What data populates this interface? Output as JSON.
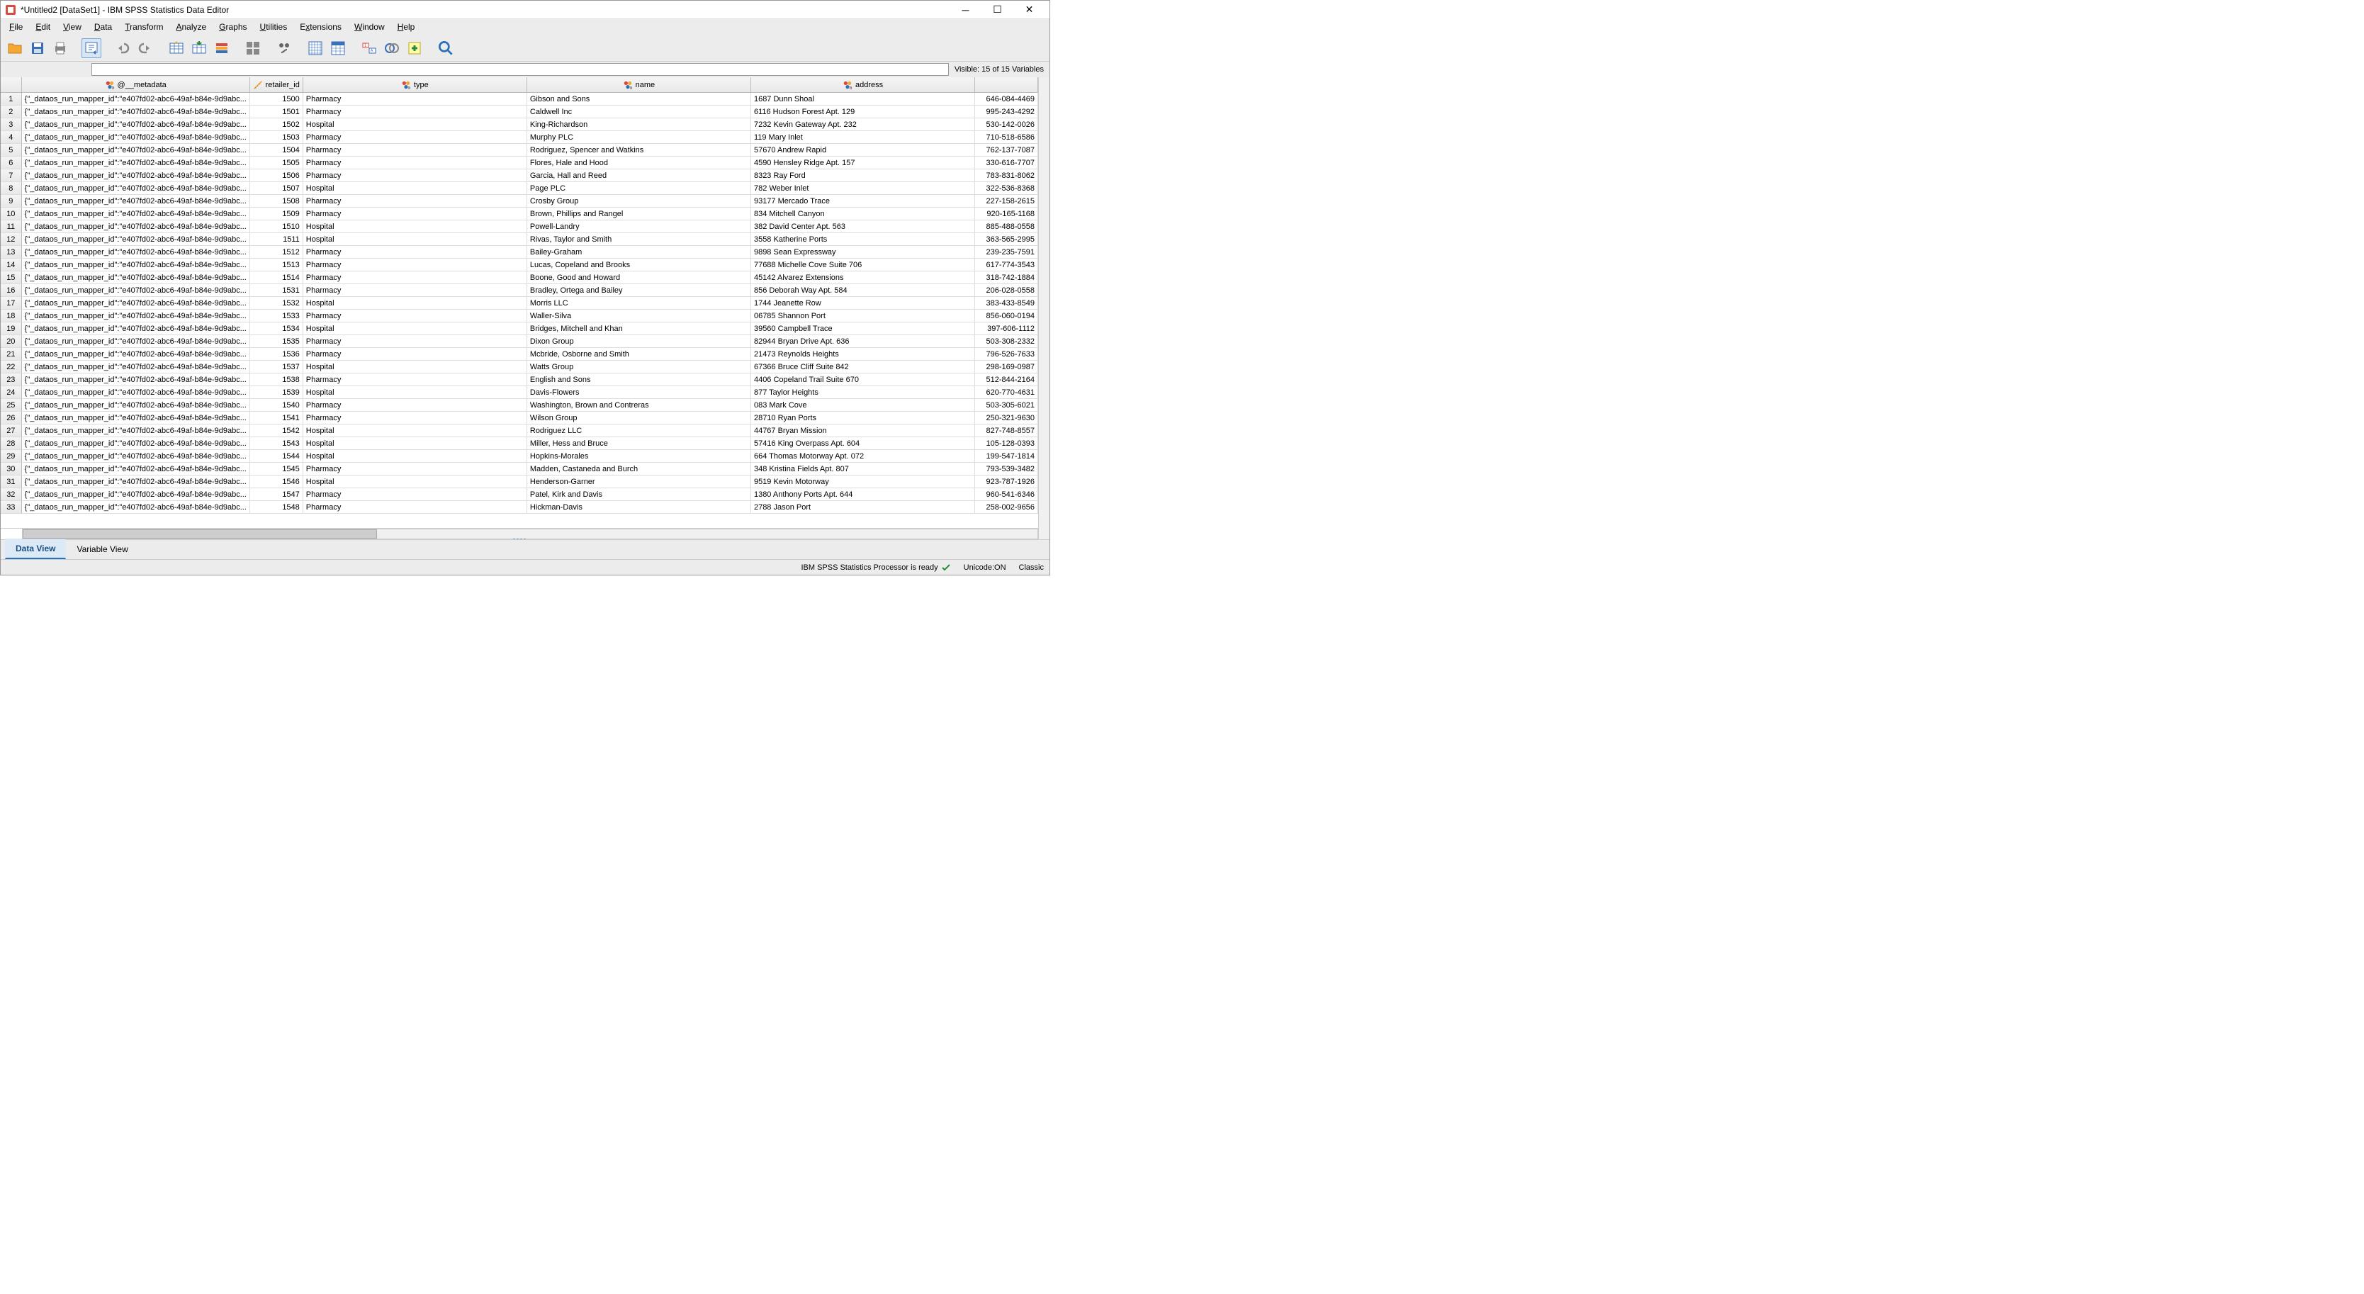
{
  "window": {
    "title": "*Untitled2 [DataSet1] - IBM SPSS Statistics Data Editor"
  },
  "menus": {
    "file": "File",
    "edit": "Edit",
    "view": "View",
    "data": "Data",
    "transform": "Transform",
    "analyze": "Analyze",
    "graphs": "Graphs",
    "utilities": "Utilities",
    "extensions": "Extensions",
    "window": "Window",
    "help": "Help"
  },
  "info": {
    "visible": "Visible: 15 of 15 Variables"
  },
  "columns": {
    "metadata": "@__metadata",
    "retailer_id": "retailer_id",
    "type": "type",
    "name": "name",
    "address": "address"
  },
  "metadata_text": "{\"_dataos_run_mapper_id\":\"e407fd02-abc6-49af-b84e-9d9abc...",
  "rows": [
    {
      "n": 1,
      "id": "1500",
      "type": "Pharmacy",
      "name": "Gibson and Sons",
      "addr": "1687 Dunn Shoal",
      "ph": "646-084-4469"
    },
    {
      "n": 2,
      "id": "1501",
      "type": "Pharmacy",
      "name": "Caldwell Inc",
      "addr": "6116 Hudson Forest Apt. 129",
      "ph": "995-243-4292"
    },
    {
      "n": 3,
      "id": "1502",
      "type": "Hospital",
      "name": "King-Richardson",
      "addr": "7232 Kevin Gateway Apt. 232",
      "ph": "530-142-0026"
    },
    {
      "n": 4,
      "id": "1503",
      "type": "Pharmacy",
      "name": "Murphy PLC",
      "addr": "119 Mary Inlet",
      "ph": "710-518-6586"
    },
    {
      "n": 5,
      "id": "1504",
      "type": "Pharmacy",
      "name": "Rodriguez, Spencer and Watkins",
      "addr": "57670 Andrew Rapid",
      "ph": "762-137-7087"
    },
    {
      "n": 6,
      "id": "1505",
      "type": "Pharmacy",
      "name": "Flores, Hale and Hood",
      "addr": "4590 Hensley Ridge Apt. 157",
      "ph": "330-616-7707"
    },
    {
      "n": 7,
      "id": "1506",
      "type": "Pharmacy",
      "name": "Garcia, Hall and Reed",
      "addr": "8323 Ray Ford",
      "ph": "783-831-8062"
    },
    {
      "n": 8,
      "id": "1507",
      "type": "Hospital",
      "name": "Page PLC",
      "addr": "782 Weber Inlet",
      "ph": "322-536-8368"
    },
    {
      "n": 9,
      "id": "1508",
      "type": "Pharmacy",
      "name": "Crosby Group",
      "addr": "93177 Mercado Trace",
      "ph": "227-158-2615"
    },
    {
      "n": 10,
      "id": "1509",
      "type": "Pharmacy",
      "name": "Brown, Phillips and Rangel",
      "addr": "834 Mitchell Canyon",
      "ph": "920-165-1168"
    },
    {
      "n": 11,
      "id": "1510",
      "type": "Hospital",
      "name": "Powell-Landry",
      "addr": "382 David Center Apt. 563",
      "ph": "885-488-0558"
    },
    {
      "n": 12,
      "id": "1511",
      "type": "Hospital",
      "name": "Rivas, Taylor and Smith",
      "addr": "3558 Katherine Ports",
      "ph": "363-565-2995"
    },
    {
      "n": 13,
      "id": "1512",
      "type": "Pharmacy",
      "name": "Bailey-Graham",
      "addr": "9898 Sean Expressway",
      "ph": "239-235-7591"
    },
    {
      "n": 14,
      "id": "1513",
      "type": "Pharmacy",
      "name": "Lucas, Copeland and Brooks",
      "addr": "77688 Michelle Cove Suite 706",
      "ph": "617-774-3543"
    },
    {
      "n": 15,
      "id": "1514",
      "type": "Pharmacy",
      "name": "Boone, Good and Howard",
      "addr": "45142 Alvarez Extensions",
      "ph": "318-742-1884"
    },
    {
      "n": 16,
      "id": "1531",
      "type": "Pharmacy",
      "name": "Bradley, Ortega and Bailey",
      "addr": "856 Deborah Way Apt. 584",
      "ph": "206-028-0558"
    },
    {
      "n": 17,
      "id": "1532",
      "type": "Hospital",
      "name": "Morris LLC",
      "addr": "1744 Jeanette Row",
      "ph": "383-433-8549"
    },
    {
      "n": 18,
      "id": "1533",
      "type": "Pharmacy",
      "name": "Waller-Silva",
      "addr": "06785 Shannon Port",
      "ph": "856-060-0194"
    },
    {
      "n": 19,
      "id": "1534",
      "type": "Hospital",
      "name": "Bridges, Mitchell and Khan",
      "addr": "39560 Campbell Trace",
      "ph": "397-606-1112"
    },
    {
      "n": 20,
      "id": "1535",
      "type": "Pharmacy",
      "name": "Dixon Group",
      "addr": "82944 Bryan Drive Apt. 636",
      "ph": "503-308-2332"
    },
    {
      "n": 21,
      "id": "1536",
      "type": "Pharmacy",
      "name": "Mcbride, Osborne and Smith",
      "addr": "21473 Reynolds Heights",
      "ph": "796-526-7633"
    },
    {
      "n": 22,
      "id": "1537",
      "type": "Hospital",
      "name": "Watts Group",
      "addr": "67366 Bruce Cliff Suite 842",
      "ph": "298-169-0987"
    },
    {
      "n": 23,
      "id": "1538",
      "type": "Pharmacy",
      "name": "English and Sons",
      "addr": "4406 Copeland Trail Suite 670",
      "ph": "512-844-2164"
    },
    {
      "n": 24,
      "id": "1539",
      "type": "Hospital",
      "name": "Davis-Flowers",
      "addr": "877 Taylor Heights",
      "ph": "620-770-4631"
    },
    {
      "n": 25,
      "id": "1540",
      "type": "Pharmacy",
      "name": "Washington, Brown and Contreras",
      "addr": "083 Mark Cove",
      "ph": "503-305-6021"
    },
    {
      "n": 26,
      "id": "1541",
      "type": "Pharmacy",
      "name": "Wilson Group",
      "addr": "28710 Ryan Ports",
      "ph": "250-321-9630"
    },
    {
      "n": 27,
      "id": "1542",
      "type": "Hospital",
      "name": "Rodriguez LLC",
      "addr": "44767 Bryan Mission",
      "ph": "827-748-8557"
    },
    {
      "n": 28,
      "id": "1543",
      "type": "Hospital",
      "name": "Miller, Hess and Bruce",
      "addr": "57416 King Overpass Apt. 604",
      "ph": "105-128-0393"
    },
    {
      "n": 29,
      "id": "1544",
      "type": "Hospital",
      "name": "Hopkins-Morales",
      "addr": "664 Thomas Motorway Apt. 072",
      "ph": "199-547-1814"
    },
    {
      "n": 30,
      "id": "1545",
      "type": "Pharmacy",
      "name": "Madden, Castaneda and Burch",
      "addr": "348 Kristina Fields Apt. 807",
      "ph": "793-539-3482"
    },
    {
      "n": 31,
      "id": "1546",
      "type": "Hospital",
      "name": "Henderson-Garner",
      "addr": "9519 Kevin Motorway",
      "ph": "923-787-1926"
    },
    {
      "n": 32,
      "id": "1547",
      "type": "Pharmacy",
      "name": "Patel, Kirk and Davis",
      "addr": "1380 Anthony Ports Apt. 644",
      "ph": "960-541-6346"
    },
    {
      "n": 33,
      "id": "1548",
      "type": "Pharmacy",
      "name": "Hickman-Davis",
      "addr": "2788 Jason Port",
      "ph": "258-002-9656"
    }
  ],
  "tabs": {
    "data_view": "Data View",
    "variable_view": "Variable View"
  },
  "status": {
    "processor": "IBM SPSS Statistics Processor is ready",
    "unicode": "Unicode:ON",
    "mode": "Classic"
  }
}
